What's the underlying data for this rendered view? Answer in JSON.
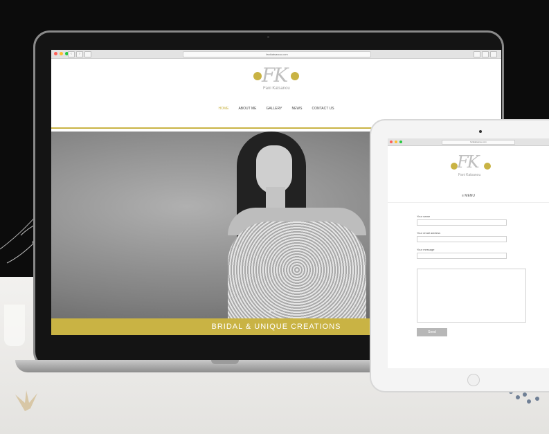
{
  "desktop": {
    "url": "fanikatsanou.com",
    "logo_initials": "FK",
    "logo_name": "Fani Katsanou",
    "nav": [
      "HOME",
      "ABOUT ME",
      "GALLERY",
      "NEWS",
      "CONTACT US"
    ],
    "active_nav": "HOME",
    "banner": "BRIDAL  &  UNIQUE  CREATIONS"
  },
  "tablet": {
    "url": "fanikatsanou.com",
    "logo_initials": "FK",
    "logo_name": "Fani Katsanou",
    "menu": "≡ MENU",
    "form": {
      "name_label": "Your name",
      "email_label": "Your email address",
      "message_label": "Your message",
      "send_label": "Send"
    }
  },
  "colors": {
    "gold": "#c9b344",
    "backdrop": "#0c0c0c"
  }
}
